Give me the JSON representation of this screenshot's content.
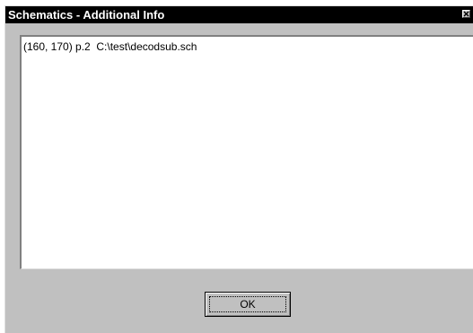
{
  "window": {
    "title": "Schematics - Additional Info"
  },
  "icons": {
    "close": "close-icon"
  },
  "list": {
    "items": [
      {
        "label": "(160, 170) p.2  C:\\test\\decodsub.sch"
      }
    ]
  },
  "buttons": {
    "ok_label": "OK"
  },
  "colors": {
    "titlebar_bg": "#000000",
    "titlebar_text": "#ffffff",
    "dialog_bg": "#c0c0c0",
    "list_bg": "#ffffff"
  }
}
